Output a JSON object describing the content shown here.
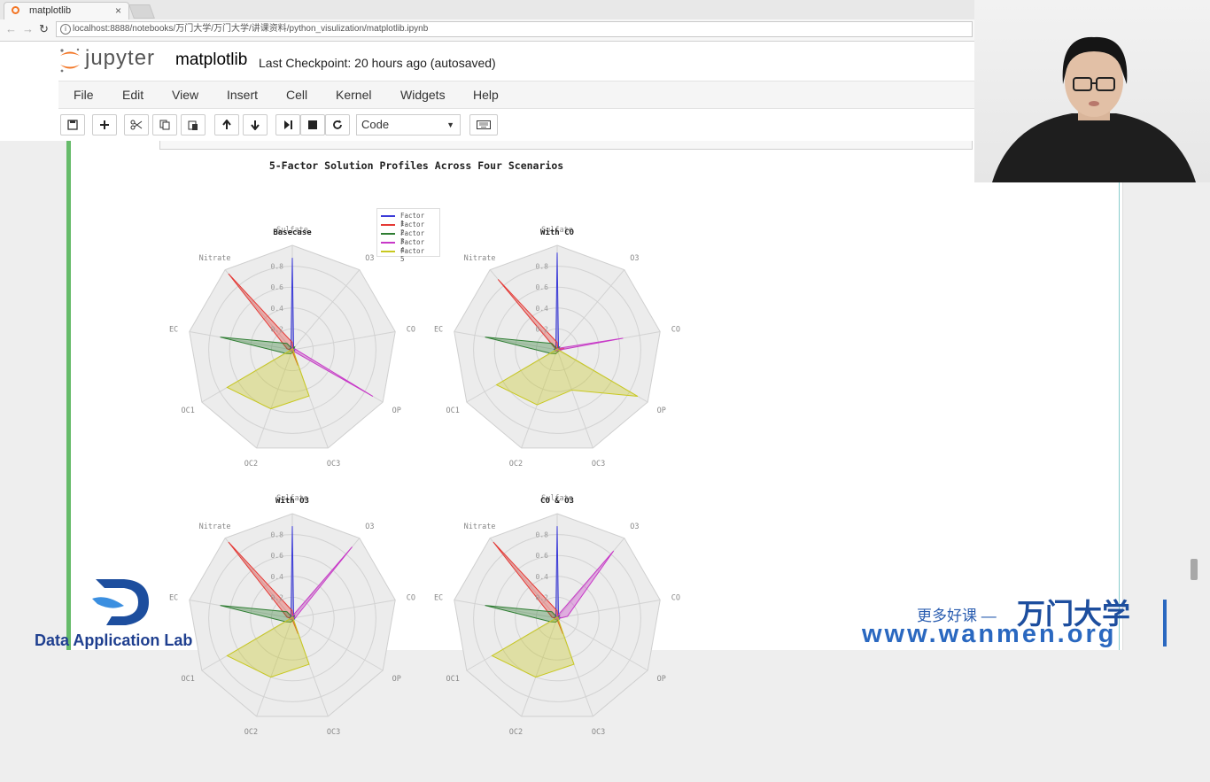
{
  "browser": {
    "tab_title": "matplotlib",
    "tab_close": "×",
    "url": "localhost:8888/notebooks/万门大学/万门大学/讲课资料/python_visulization/matplotlib.ipynb"
  },
  "jupyter": {
    "logo_text": "jupyter",
    "notebook_name": "matplotlib",
    "checkpoint": "Last Checkpoint: 20 hours ago (autosaved)",
    "menu": [
      "File",
      "Edit",
      "View",
      "Insert",
      "Cell",
      "Kernel",
      "Widgets",
      "Help"
    ],
    "cell_type": "Code"
  },
  "colors": {
    "accent_green": "#66bb6a",
    "factor_colors": [
      "#3b3bd8",
      "#e53935",
      "#2e7d32",
      "#c838c8",
      "#c8c820"
    ]
  },
  "figure_title": "5-Factor Solution Profiles Across Four Scenarios",
  "chart_data": {
    "type": "radar",
    "spokes": [
      "Sulfate",
      "O3",
      "CO",
      "OP",
      "OC3",
      "OC2",
      "OC1",
      "EC",
      "Nitrate"
    ],
    "rlabels": [
      "0.2",
      "0.4",
      "0.6",
      "0.8"
    ],
    "legend": [
      "Factor 1",
      "Factor 2",
      "Factor 3",
      "Factor 4",
      "Factor 5"
    ],
    "subplots": [
      {
        "title": "Basecase",
        "series": [
          [
            0.88,
            0.02,
            0.03,
            0.02,
            0.01,
            0.01,
            0.02,
            0.03,
            0.02
          ],
          [
            0.07,
            0.01,
            0.01,
            0.01,
            0.16,
            0.01,
            0.01,
            0.05,
            0.95
          ],
          [
            0.01,
            0.04,
            0.01,
            0.02,
            0.02,
            0.04,
            0.07,
            0.7,
            0.08
          ],
          [
            0.02,
            0.01,
            0.03,
            0.89,
            0.01,
            0.01,
            0.01,
            0.01,
            0.01
          ],
          [
            0.01,
            0.01,
            0.01,
            0.01,
            0.47,
            0.6,
            0.72,
            0.01,
            0.01
          ]
        ]
      },
      {
        "title": "With CO",
        "series": [
          [
            0.93,
            0.02,
            0.03,
            0.02,
            0.01,
            0.01,
            0.02,
            0.03,
            0.02
          ],
          [
            0.07,
            0.01,
            0.07,
            0.02,
            0.02,
            0.01,
            0.01,
            0.01,
            0.88
          ],
          [
            0.01,
            0.04,
            0.01,
            0.02,
            0.02,
            0.04,
            0.07,
            0.7,
            0.08
          ],
          [
            0.01,
            0.02,
            0.64,
            0.01,
            0.01,
            0.01,
            0.01,
            0.01,
            0.01
          ],
          [
            0.01,
            0.01,
            0.01,
            0.89,
            0.41,
            0.56,
            0.67,
            0.01,
            0.01
          ]
        ]
      },
      {
        "title": "With O3",
        "series": [
          [
            0.88,
            0.02,
            0.03,
            0.02,
            0.01,
            0.01,
            0.02,
            0.03,
            0.02
          ],
          [
            0.07,
            0.01,
            0.01,
            0.01,
            0.16,
            0.01,
            0.01,
            0.05,
            0.95
          ],
          [
            0.01,
            0.04,
            0.01,
            0.02,
            0.02,
            0.04,
            0.07,
            0.7,
            0.08
          ],
          [
            0.02,
            0.89,
            0.03,
            0.01,
            0.01,
            0.01,
            0.01,
            0.01,
            0.01
          ],
          [
            0.01,
            0.01,
            0.01,
            0.01,
            0.47,
            0.6,
            0.72,
            0.01,
            0.01
          ]
        ]
      },
      {
        "title": "CO & O3",
        "series": [
          [
            0.88,
            0.02,
            0.03,
            0.02,
            0.01,
            0.01,
            0.02,
            0.03,
            0.02
          ],
          [
            0.07,
            0.01,
            0.01,
            0.01,
            0.16,
            0.01,
            0.01,
            0.05,
            0.95
          ],
          [
            0.01,
            0.04,
            0.01,
            0.02,
            0.02,
            0.04,
            0.07,
            0.7,
            0.08
          ],
          [
            0.02,
            0.84,
            0.1,
            0.01,
            0.01,
            0.01,
            0.01,
            0.01,
            0.01
          ],
          [
            0.01,
            0.01,
            0.01,
            0.01,
            0.47,
            0.6,
            0.72,
            0.01,
            0.01
          ]
        ]
      }
    ]
  },
  "watermark": {
    "brand_text": "Data Application Lab",
    "promo_small": "更多好课 —",
    "promo_big": "万门大学",
    "promo_url": "www.wanmen.org"
  }
}
